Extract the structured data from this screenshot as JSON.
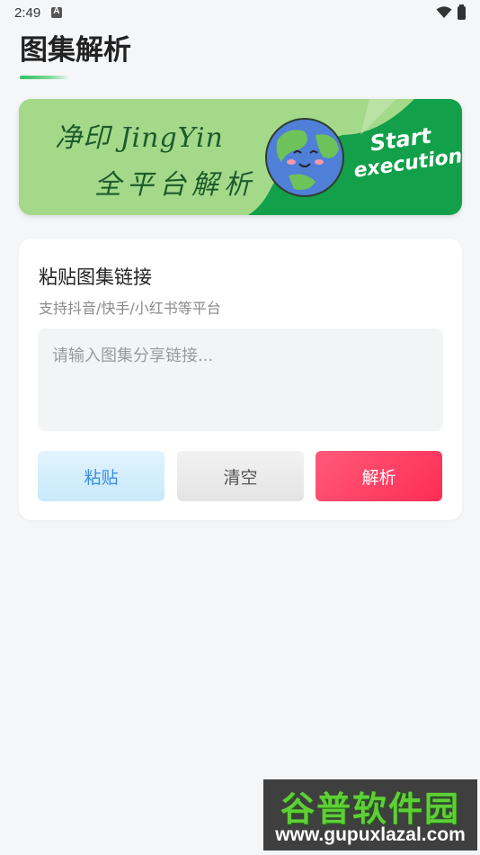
{
  "status_bar": {
    "time": "2:49"
  },
  "header": {
    "title": "图集解析"
  },
  "banner": {
    "line1": "净印 JingYin",
    "line2": "全平台解析",
    "cta_line1": "Start",
    "cta_line2": "execution"
  },
  "card": {
    "title": "粘贴图集链接",
    "subtitle": "支持抖音/快手/小红书等平台",
    "input_placeholder": "请输入图集分享链接...",
    "input_value": "",
    "buttons": {
      "paste": "粘贴",
      "clear": "清空",
      "parse": "解析"
    }
  },
  "watermark": {
    "title": "谷普软件园",
    "url": "www.gupuxlazal.com"
  },
  "colors": {
    "accent_green": "#2fbf63",
    "paste_blue": "#3a8ee6",
    "parse_red": "#ff2d55"
  }
}
